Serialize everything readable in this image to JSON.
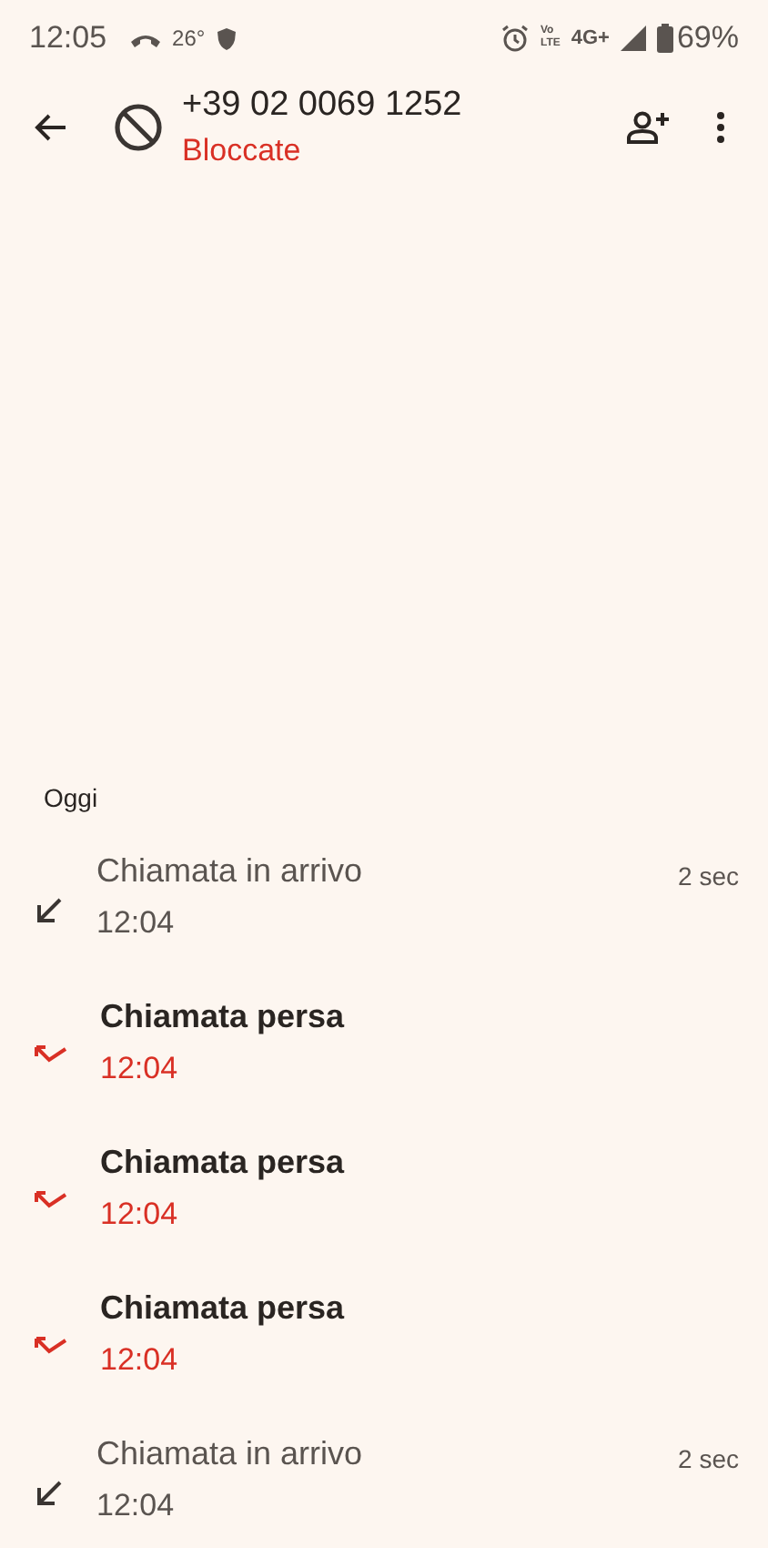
{
  "status_bar": {
    "time": "12:05",
    "temperature": "26°",
    "volte_top": "Vo",
    "volte_bottom": "LTE",
    "network": "4G+",
    "battery": "69%"
  },
  "header": {
    "number": "+39 02 0069 1252",
    "status": "Bloccate"
  },
  "section": "Oggi",
  "calls": [
    {
      "kind": "incoming",
      "title": "Chiamata in arrivo",
      "time": "12:04",
      "duration": "2 sec"
    },
    {
      "kind": "missed",
      "title": "Chiamata persa",
      "time": "12:04"
    },
    {
      "kind": "missed",
      "title": "Chiamata persa",
      "time": "12:04"
    },
    {
      "kind": "missed",
      "title": "Chiamata persa",
      "time": "12:04"
    },
    {
      "kind": "incoming",
      "title": "Chiamata in arrivo",
      "time": "12:04",
      "duration": "2 sec"
    }
  ]
}
